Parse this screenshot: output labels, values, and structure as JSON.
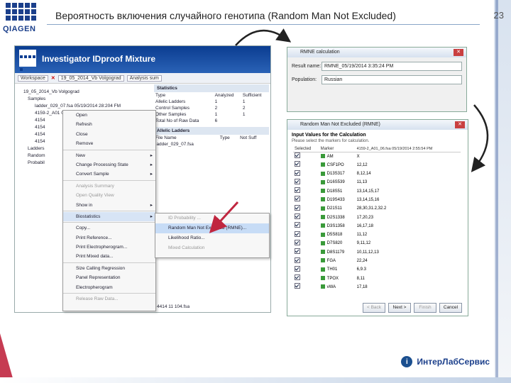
{
  "slide": {
    "title": "Вероятность включения случайного генотипа  (Random Man Not Excluded)",
    "number": "23",
    "logo_text": "QIAGEN",
    "footer_brand": "ИнтерЛабСервис"
  },
  "app": {
    "title": "Investigator IDproof Mixture",
    "workspace_tab": "Workspace",
    "doc_tab": "19_05_2014_Vb Volgograd",
    "analysis_tab": "Analysis sum",
    "tree": [
      "19_05_2014_Vb Volgograd",
      "Samples",
      "ladder_029_07.fsa 05/19/2014 28:204 FM",
      "4159-2_A01 06.fsa 05/19/2014 25:04 PM",
      "4154",
      "4154",
      "4154",
      "4154",
      "Ladders",
      "Random",
      "Probabil"
    ],
    "stats": {
      "header": "Statistics",
      "cols": [
        "Type",
        "Analyzed",
        "Sufficient"
      ],
      "rows": [
        [
          "Allelic Ladders",
          "1",
          "1"
        ],
        [
          "Control Samples",
          "2",
          "2"
        ],
        [
          "Other Samples",
          "1",
          "1"
        ],
        [
          "Total No of Raw Data",
          "6",
          ""
        ]
      ],
      "ladders_header": "Allelic Ladders",
      "ladders_cols": [
        "File Name",
        "Type",
        "Not Suff"
      ],
      "ladder_file": "ladder_029_07.fsa",
      "last_file": "4414 11 104.fsa"
    }
  },
  "context_menu": {
    "items": [
      "Open",
      "Refresh",
      "Close",
      "Remove",
      "New",
      "Change Processing State",
      "Convert Sample",
      "Analysis Summary",
      "Open Quality View",
      "Show in",
      "Biostatistics",
      "Copy...",
      "Print Reference...",
      "Print Electropherogram...",
      "Print Mixed data...",
      "Size Calling Regression",
      "Panel Representation",
      "Electropherogram",
      "Release Raw Data..."
    ],
    "submenu": [
      "ID Probability ...",
      "Random Man Not Excluded (RMNE)...",
      "Likelihood Ratio...",
      "Mixed Calculation"
    ]
  },
  "rmne_dialog": {
    "title": "RMNE calculation",
    "result_label": "Result name:",
    "result_value": "RMNE_05/19/2014 3:35:24 PM",
    "population_label": "Population:",
    "population_value": "Russian"
  },
  "input_dialog": {
    "title": "Random Man Not Excluded (RMNE)",
    "heading": "Input Values for the Calculation",
    "subheading": "Please select the markers for calculation.",
    "cols": [
      "Selected",
      "Marker",
      "4159-2_A01_06.fsa 05/19/2014 2:55:54 PM"
    ],
    "rows": [
      [
        "AM",
        "X"
      ],
      [
        "CSF1PO",
        "12,12"
      ],
      [
        "D13S317",
        "8,12,14"
      ],
      [
        "D16S539",
        "11,13"
      ],
      [
        "D18S51",
        "13,14,15,17"
      ],
      [
        "D19S433",
        "13,14,15,16"
      ],
      [
        "D21S11",
        "28,30,31.2,32.2"
      ],
      [
        "D2S1338",
        "17,20,23"
      ],
      [
        "D3S1358",
        "16,17,18"
      ],
      [
        "D5S818",
        "11,12"
      ],
      [
        "D7S820",
        "9,11,12"
      ],
      [
        "D8S1179",
        "10,11,12,13"
      ],
      [
        "FGA",
        "22,24"
      ],
      [
        "TH01",
        "6,9.3"
      ],
      [
        "TPOX",
        "8,11"
      ],
      [
        "vWA",
        "17,18"
      ]
    ],
    "buttons": [
      "< Back",
      "Next >",
      "Finish",
      "Cancel"
    ]
  }
}
